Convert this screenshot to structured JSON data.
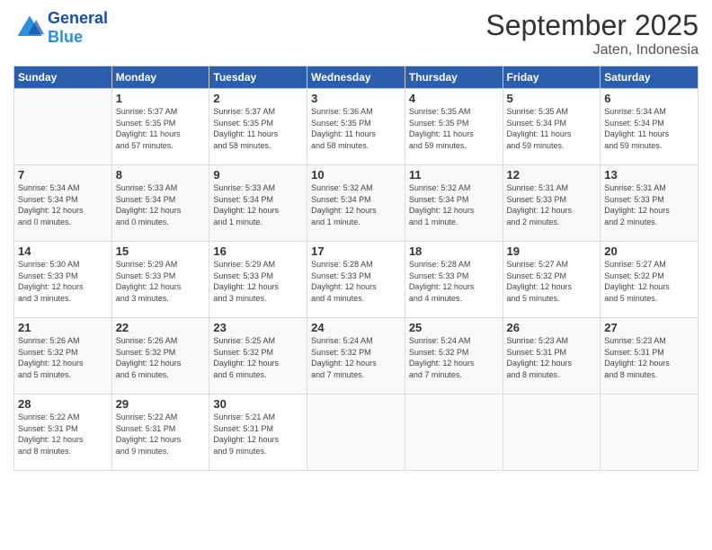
{
  "header": {
    "logo": {
      "general": "General",
      "blue": "Blue"
    },
    "title": "September 2025",
    "subtitle": "Jaten, Indonesia"
  },
  "weekdays": [
    "Sunday",
    "Monday",
    "Tuesday",
    "Wednesday",
    "Thursday",
    "Friday",
    "Saturday"
  ],
  "weeks": [
    [
      {
        "day": "",
        "info": ""
      },
      {
        "day": "1",
        "info": "Sunrise: 5:37 AM\nSunset: 5:35 PM\nDaylight: 11 hours\nand 57 minutes."
      },
      {
        "day": "2",
        "info": "Sunrise: 5:37 AM\nSunset: 5:35 PM\nDaylight: 11 hours\nand 58 minutes."
      },
      {
        "day": "3",
        "info": "Sunrise: 5:36 AM\nSunset: 5:35 PM\nDaylight: 11 hours\nand 58 minutes."
      },
      {
        "day": "4",
        "info": "Sunrise: 5:35 AM\nSunset: 5:35 PM\nDaylight: 11 hours\nand 59 minutes."
      },
      {
        "day": "5",
        "info": "Sunrise: 5:35 AM\nSunset: 5:34 PM\nDaylight: 11 hours\nand 59 minutes."
      },
      {
        "day": "6",
        "info": "Sunrise: 5:34 AM\nSunset: 5:34 PM\nDaylight: 11 hours\nand 59 minutes."
      }
    ],
    [
      {
        "day": "7",
        "info": "Sunrise: 5:34 AM\nSunset: 5:34 PM\nDaylight: 12 hours\nand 0 minutes."
      },
      {
        "day": "8",
        "info": "Sunrise: 5:33 AM\nSunset: 5:34 PM\nDaylight: 12 hours\nand 0 minutes."
      },
      {
        "day": "9",
        "info": "Sunrise: 5:33 AM\nSunset: 5:34 PM\nDaylight: 12 hours\nand 1 minute."
      },
      {
        "day": "10",
        "info": "Sunrise: 5:32 AM\nSunset: 5:34 PM\nDaylight: 12 hours\nand 1 minute."
      },
      {
        "day": "11",
        "info": "Sunrise: 5:32 AM\nSunset: 5:34 PM\nDaylight: 12 hours\nand 1 minute."
      },
      {
        "day": "12",
        "info": "Sunrise: 5:31 AM\nSunset: 5:33 PM\nDaylight: 12 hours\nand 2 minutes."
      },
      {
        "day": "13",
        "info": "Sunrise: 5:31 AM\nSunset: 5:33 PM\nDaylight: 12 hours\nand 2 minutes."
      }
    ],
    [
      {
        "day": "14",
        "info": "Sunrise: 5:30 AM\nSunset: 5:33 PM\nDaylight: 12 hours\nand 3 minutes."
      },
      {
        "day": "15",
        "info": "Sunrise: 5:29 AM\nSunset: 5:33 PM\nDaylight: 12 hours\nand 3 minutes."
      },
      {
        "day": "16",
        "info": "Sunrise: 5:29 AM\nSunset: 5:33 PM\nDaylight: 12 hours\nand 3 minutes."
      },
      {
        "day": "17",
        "info": "Sunrise: 5:28 AM\nSunset: 5:33 PM\nDaylight: 12 hours\nand 4 minutes."
      },
      {
        "day": "18",
        "info": "Sunrise: 5:28 AM\nSunset: 5:33 PM\nDaylight: 12 hours\nand 4 minutes."
      },
      {
        "day": "19",
        "info": "Sunrise: 5:27 AM\nSunset: 5:32 PM\nDaylight: 12 hours\nand 5 minutes."
      },
      {
        "day": "20",
        "info": "Sunrise: 5:27 AM\nSunset: 5:32 PM\nDaylight: 12 hours\nand 5 minutes."
      }
    ],
    [
      {
        "day": "21",
        "info": "Sunrise: 5:26 AM\nSunset: 5:32 PM\nDaylight: 12 hours\nand 5 minutes."
      },
      {
        "day": "22",
        "info": "Sunrise: 5:26 AM\nSunset: 5:32 PM\nDaylight: 12 hours\nand 6 minutes."
      },
      {
        "day": "23",
        "info": "Sunrise: 5:25 AM\nSunset: 5:32 PM\nDaylight: 12 hours\nand 6 minutes."
      },
      {
        "day": "24",
        "info": "Sunrise: 5:24 AM\nSunset: 5:32 PM\nDaylight: 12 hours\nand 7 minutes."
      },
      {
        "day": "25",
        "info": "Sunrise: 5:24 AM\nSunset: 5:32 PM\nDaylight: 12 hours\nand 7 minutes."
      },
      {
        "day": "26",
        "info": "Sunrise: 5:23 AM\nSunset: 5:31 PM\nDaylight: 12 hours\nand 8 minutes."
      },
      {
        "day": "27",
        "info": "Sunrise: 5:23 AM\nSunset: 5:31 PM\nDaylight: 12 hours\nand 8 minutes."
      }
    ],
    [
      {
        "day": "28",
        "info": "Sunrise: 5:22 AM\nSunset: 5:31 PM\nDaylight: 12 hours\nand 8 minutes."
      },
      {
        "day": "29",
        "info": "Sunrise: 5:22 AM\nSunset: 5:31 PM\nDaylight: 12 hours\nand 9 minutes."
      },
      {
        "day": "30",
        "info": "Sunrise: 5:21 AM\nSunset: 5:31 PM\nDaylight: 12 hours\nand 9 minutes."
      },
      {
        "day": "",
        "info": ""
      },
      {
        "day": "",
        "info": ""
      },
      {
        "day": "",
        "info": ""
      },
      {
        "day": "",
        "info": ""
      }
    ]
  ]
}
